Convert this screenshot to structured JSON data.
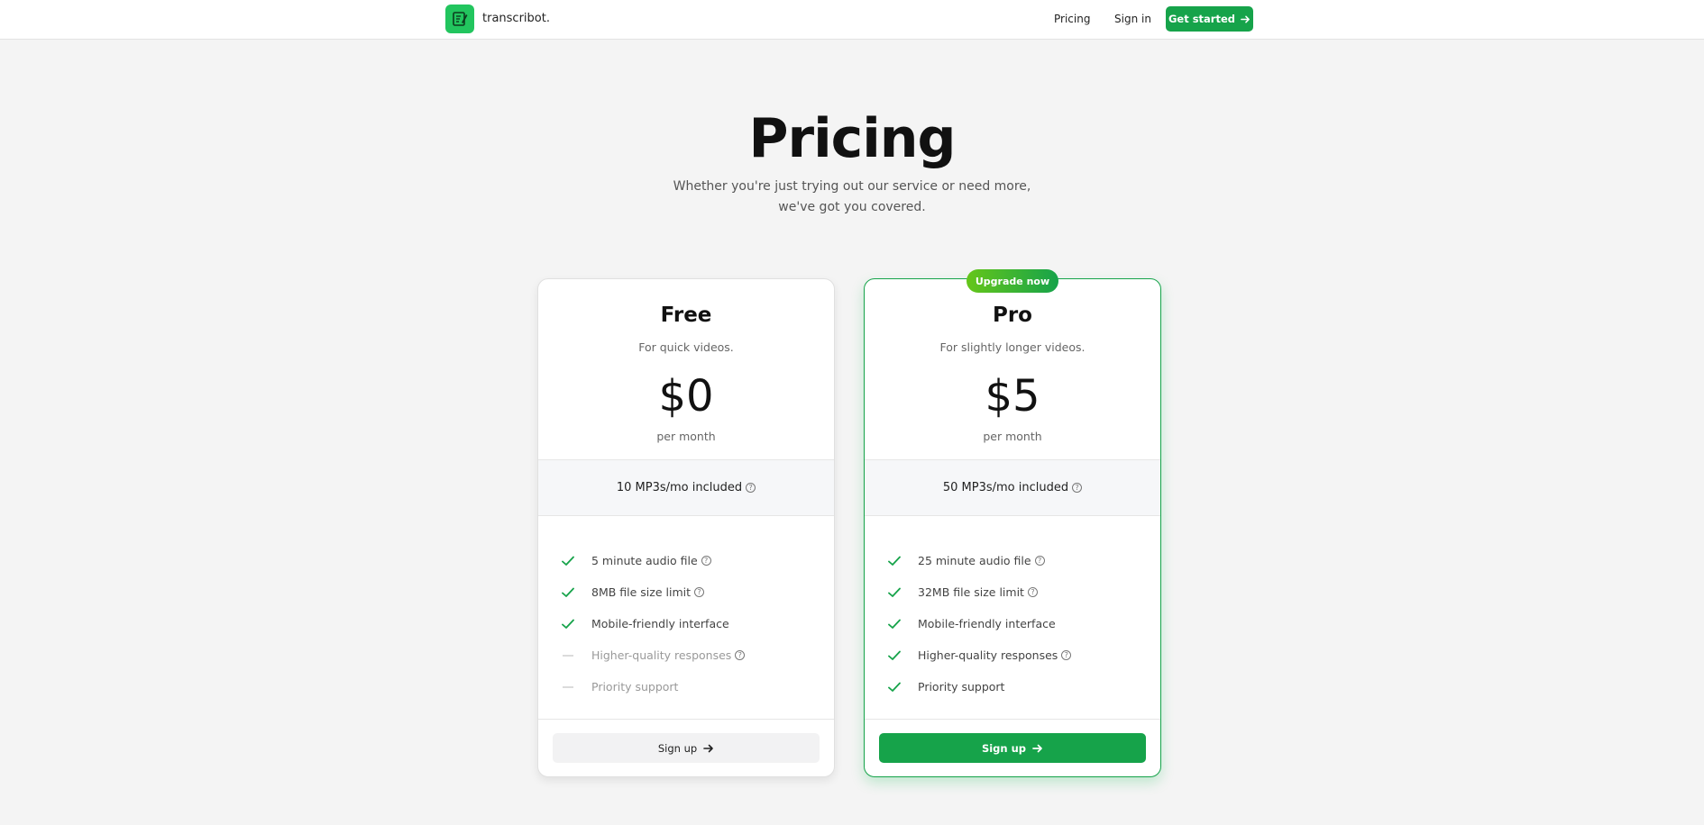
{
  "nav": {
    "brand": "transcribot.",
    "links": [
      "Pricing",
      "Sign in"
    ],
    "cta_label": "Get started"
  },
  "hero": {
    "title": "Pricing",
    "subtitle": "Whether you're just trying out our service or need more, we've got you covered."
  },
  "plans": [
    {
      "name": "Free",
      "description": "For quick videos.",
      "price": "$0",
      "period": "per month",
      "quota": "10 MP3s/mo included",
      "features": [
        {
          "label": "5 minute audio file",
          "included": true,
          "help": true
        },
        {
          "label": "8MB file size limit",
          "included": true,
          "help": true
        },
        {
          "label": "Mobile-friendly interface",
          "included": true,
          "help": false
        },
        {
          "label": "Higher-quality responses",
          "included": false,
          "help": true
        },
        {
          "label": "Priority support",
          "included": false,
          "help": false
        }
      ],
      "button_label": "Sign up"
    },
    {
      "name": "Pro",
      "badge": "Upgrade now",
      "description": "For slightly longer videos.",
      "price": "$5",
      "period": "per month",
      "quota": "50 MP3s/mo included",
      "features": [
        {
          "label": "25 minute audio file",
          "included": true,
          "help": true
        },
        {
          "label": "32MB file size limit",
          "included": true,
          "help": true
        },
        {
          "label": "Mobile-friendly interface",
          "included": true,
          "help": false
        },
        {
          "label": "Higher-quality responses",
          "included": true,
          "help": true
        },
        {
          "label": "Priority support",
          "included": true,
          "help": false
        }
      ],
      "button_label": "Sign up"
    }
  ],
  "colors": {
    "accent": "#16a34a",
    "logo": "#22c55e",
    "badge_gradient_start": "#65c61a"
  },
  "icons": {
    "logo": "notepad-pencil-icon",
    "arrow": "arrow-right-icon",
    "check": "check-icon",
    "dash": "dash-icon",
    "help": "question-circle-icon"
  }
}
